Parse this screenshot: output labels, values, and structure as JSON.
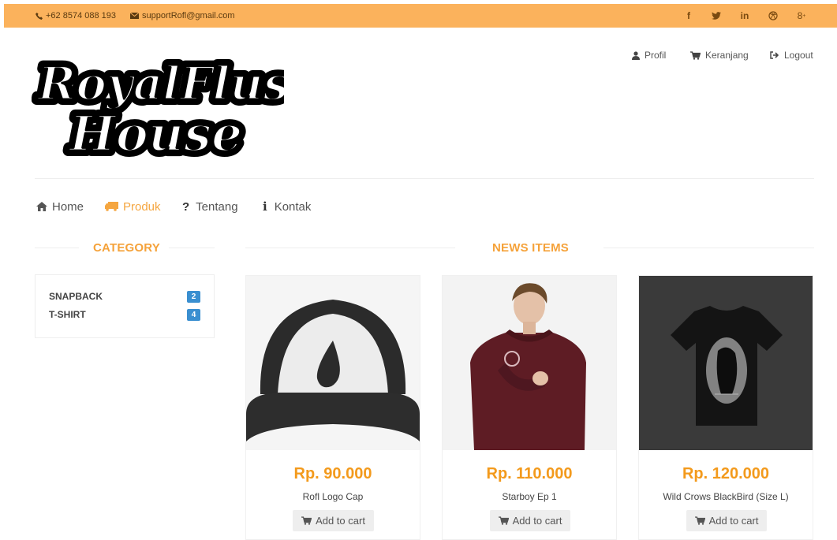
{
  "topbar": {
    "phone": "+62 8574 088 193",
    "email": "supportRofl@gmail.com",
    "social": [
      "f",
      "twitter",
      "in",
      "dribbble",
      "g+"
    ]
  },
  "logo": {
    "line1": "RoyalFlush",
    "line2": "House"
  },
  "account": {
    "profil": "Profil",
    "keranjang": "Keranjang",
    "logout": "Logout"
  },
  "nav": [
    {
      "label": "Home",
      "icon": "home-icon"
    },
    {
      "label": "Produk",
      "icon": "truck-icon",
      "active": true
    },
    {
      "label": "Tentang",
      "icon": "question-icon"
    },
    {
      "label": "Kontak",
      "icon": "info-icon"
    }
  ],
  "sidebar": {
    "title": "CATEGORY",
    "items": [
      {
        "label": "SNAPBACK",
        "count": "2"
      },
      {
        "label": "T-SHIRT",
        "count": "4"
      }
    ]
  },
  "main": {
    "title": "NEWS ITEMS",
    "products": [
      {
        "price": "Rp. 90.000",
        "name": "Rofl Logo Cap",
        "button": "Add to cart"
      },
      {
        "price": "Rp. 110.000",
        "name": "Starboy Ep 1",
        "button": "Add to cart"
      },
      {
        "price": "Rp. 120.000",
        "name": "Wild Crows BlackBird (Size L)",
        "button": "Add to cart"
      }
    ]
  },
  "colors": {
    "accent": "#f5a23a",
    "topbar": "#fbb25c",
    "badge": "#3a8fd0"
  }
}
